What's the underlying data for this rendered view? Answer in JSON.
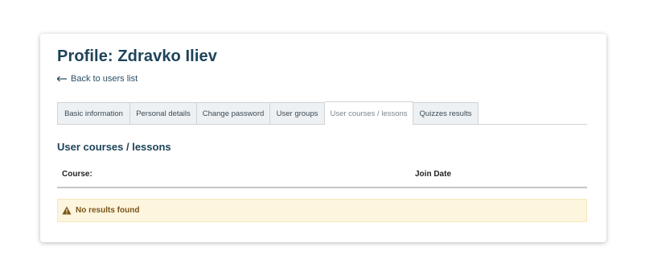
{
  "profile": {
    "title": "Profile: Zdravko Iliev",
    "back_label": "Back to users list"
  },
  "tabs": [
    {
      "label": "Basic information",
      "active": false
    },
    {
      "label": "Personal details",
      "active": false
    },
    {
      "label": "Change password",
      "active": false
    },
    {
      "label": "User groups",
      "active": false
    },
    {
      "label": "User courses / lessons",
      "active": true
    },
    {
      "label": "Quizzes results",
      "active": false
    }
  ],
  "section": {
    "title": "User courses / lessons"
  },
  "table": {
    "columns": [
      "Course:",
      "Join Date"
    ],
    "rows": []
  },
  "alert": {
    "icon": "warning-icon",
    "message": "No results found"
  },
  "colors": {
    "heading": "#1d4359",
    "tab_bg": "#eef1f3",
    "alert_bg": "#fdf5de",
    "alert_text": "#7a5418"
  }
}
